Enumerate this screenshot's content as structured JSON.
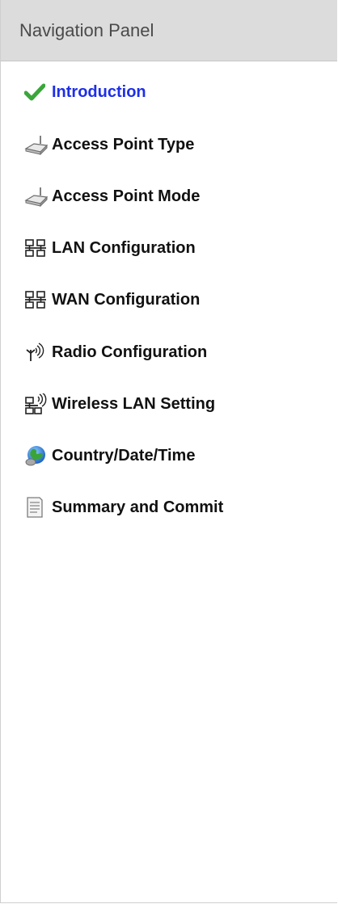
{
  "panel": {
    "title": "Navigation Panel"
  },
  "nav": {
    "items": [
      {
        "label": "Introduction",
        "icon": "check-icon",
        "active": true
      },
      {
        "label": "Access Point Type",
        "icon": "access-point-icon"
      },
      {
        "label": "Access Point Mode",
        "icon": "access-point-icon"
      },
      {
        "label": "LAN Configuration",
        "icon": "network-icon"
      },
      {
        "label": "WAN Configuration",
        "icon": "network-icon"
      },
      {
        "label": "Radio Configuration",
        "icon": "antenna-icon"
      },
      {
        "label": "Wireless LAN Setting",
        "icon": "wireless-network-icon"
      },
      {
        "label": "Country/Date/Time",
        "icon": "globe-icon"
      },
      {
        "label": "Summary and Commit",
        "icon": "document-icon"
      }
    ]
  },
  "colors": {
    "active_text": "#1e2fe6",
    "header_bg": "#dcdcdc",
    "check_green": "#3aa63a"
  }
}
